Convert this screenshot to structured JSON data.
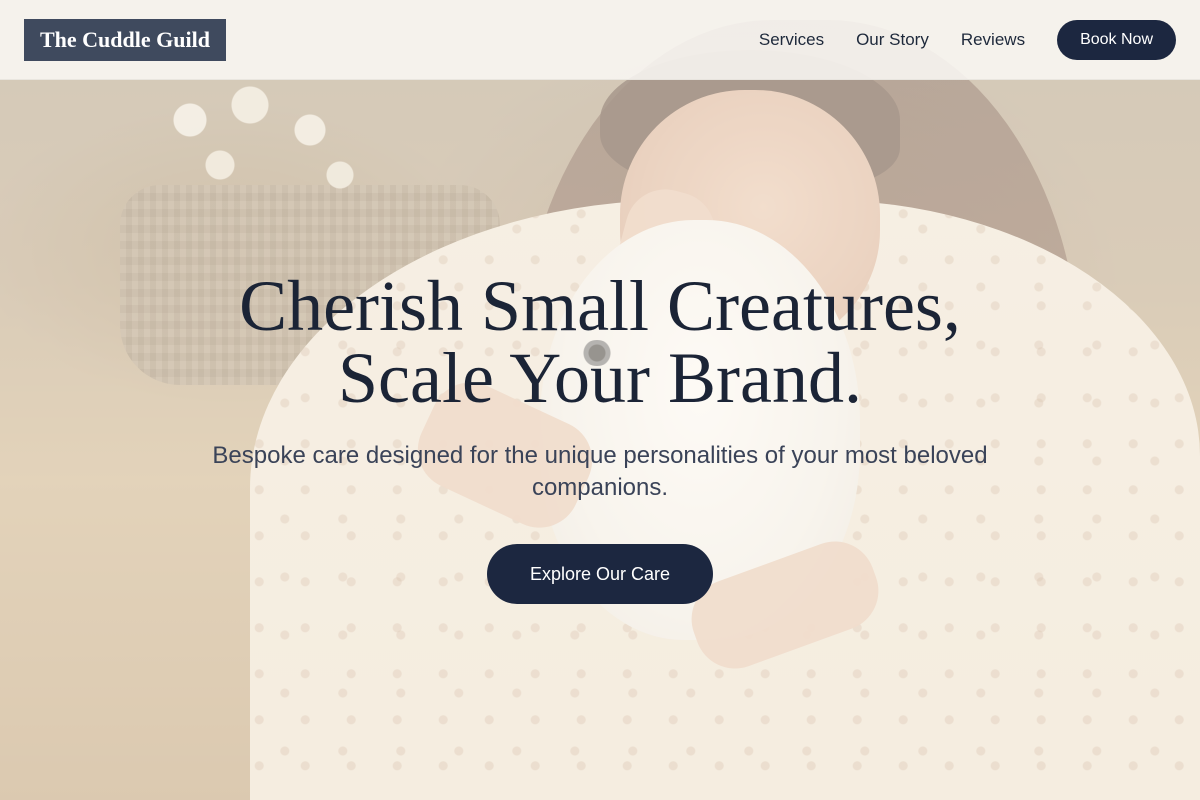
{
  "nav": {
    "logo": "The Cuddle Guild",
    "links": [
      "Services",
      "Our Story",
      "Reviews"
    ],
    "book_label": "Book Now"
  },
  "hero": {
    "headline_line1": "Cherish Small Creatures,",
    "headline_line2": "Scale Your Brand.",
    "subtitle": "Bespoke care designed for the unique personalities of your most beloved companions.",
    "cta_label": "Explore Our Care"
  },
  "colors": {
    "primary": "#1c2740",
    "logo_bg": "#3f4a5e",
    "text_dark": "#1b2436",
    "text_muted": "#3a4358"
  }
}
